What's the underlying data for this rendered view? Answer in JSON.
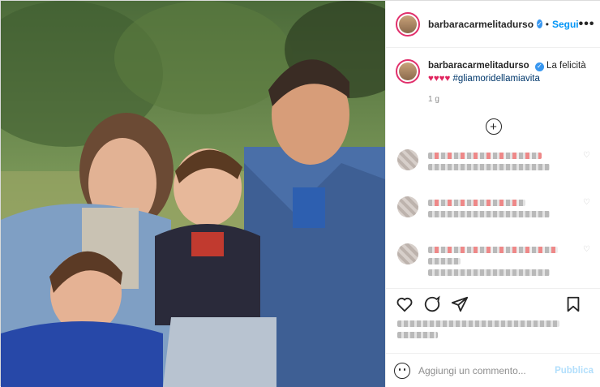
{
  "post": {
    "photo_alt": "Foto di famiglia all'aperto",
    "username": "barbaracarmelitadurso",
    "follow_label": "Segui",
    "separator": "•",
    "more_label": "•••",
    "caption": {
      "username": "barbaracarmelitadurso",
      "text": "La felicità",
      "hearts": "♥♥♥♥",
      "hashtag": "#gliamoridellamiavita"
    },
    "time_ago": "1 g",
    "load_more": "+",
    "comment_box": {
      "placeholder": "Aggiungi un commento...",
      "publish_label": "Pubblica"
    }
  },
  "colors": {
    "accent": "#0095f6",
    "heart": "#e0245e",
    "publish_disabled": "#b2dffc"
  }
}
